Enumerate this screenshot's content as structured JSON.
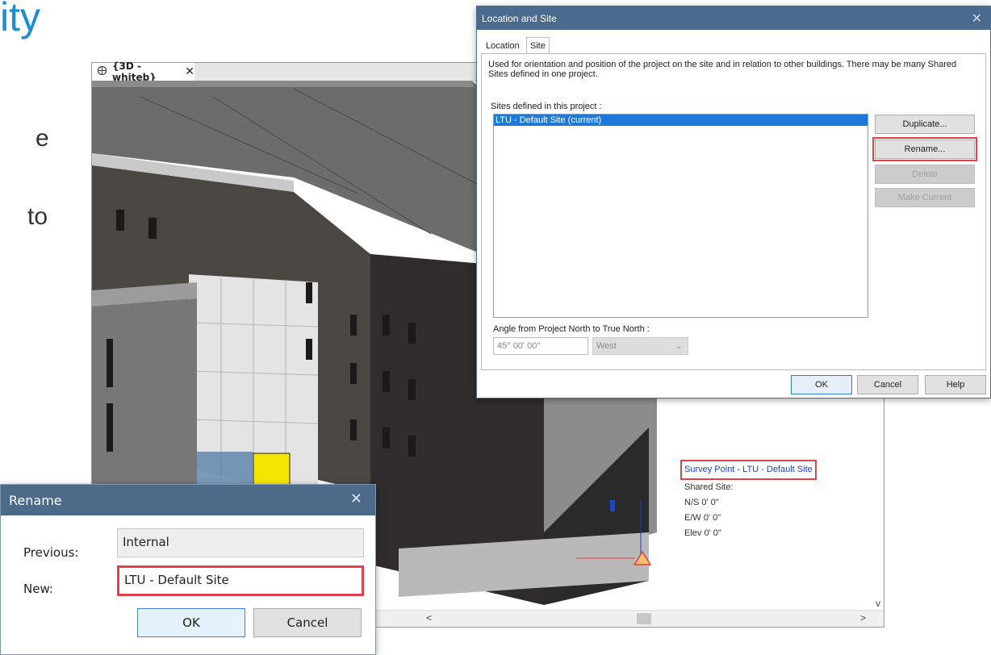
{
  "slide": {
    "title_fragment": "ity",
    "text_frag_1": "e",
    "text_frag_2": "to"
  },
  "view": {
    "tab_label": "{3D - whiteb}",
    "tab_close": "✕",
    "survey": {
      "title": "Survey Point - LTU - Default Site",
      "shared": "Shared Site:",
      "ns": "N/S  0' 0\"",
      "ew": "E/W  0' 0\"",
      "elev": "Elev  0' 0\""
    },
    "scroll_left": "<",
    "scroll_right": ">",
    "scroll_down": "v"
  },
  "location_dialog": {
    "title": "Location and Site",
    "close": "✕",
    "tabs": [
      "Location",
      "Site"
    ],
    "description": "Used for orientation and position of the project on the site and in relation to other buildings. There may be many Shared Sites defined in one project.",
    "sites_label": "Sites defined in this project :",
    "sites": [
      "LTU - Default Site (current)"
    ],
    "buttons": {
      "duplicate": "Duplicate...",
      "rename": "Rename...",
      "delete": "Delete",
      "make_current": "Make Current",
      "ok": "OK",
      "cancel": "Cancel",
      "help": "Help"
    },
    "angle_label": "Angle from Project North to True North :",
    "angle_value": "45° 00' 00\"",
    "direction": "West"
  },
  "rename_dialog": {
    "title": "Rename",
    "close": "✕",
    "previous_label": "Previous:",
    "previous_value": "Internal",
    "new_label": "New:",
    "new_value": "LTU - Default Site",
    "ok": "OK",
    "cancel": "Cancel"
  },
  "colors": {
    "accent": "#1e7ad8",
    "highlight": "#e1414a",
    "title_bar": "#4a6b8d",
    "slide_title": "#1a8fd6"
  }
}
